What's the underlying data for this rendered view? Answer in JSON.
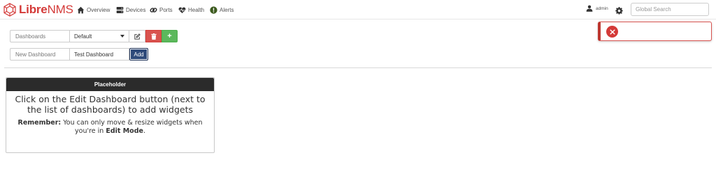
{
  "app": {
    "logo_part1": "Libre",
    "logo_part2": "NMS",
    "brand_color": "#d43a38"
  },
  "nav": {
    "items": [
      {
        "label": "Overview",
        "icon": "home-icon"
      },
      {
        "label": "Devices",
        "icon": "server-icon"
      },
      {
        "label": "Ports",
        "icon": "link-icon"
      },
      {
        "label": "Health",
        "icon": "heartbeat-icon"
      },
      {
        "label": "Alerts",
        "icon": "exclamation-circle-icon"
      }
    ],
    "user": "admin",
    "search_placeholder": "Global Search"
  },
  "dashboard": {
    "select_label": "Dashboards",
    "selected": "Default",
    "new_label": "New Dashboard",
    "new_value": "Test Dashboard",
    "add_button": "Add",
    "add_widget_symbol": "+"
  },
  "widget": {
    "title": "Placeholder",
    "message": "Click on the Edit Dashboard button (next to the list of dashboards) to add widgets",
    "remember_prefix": "Remember:",
    "remember_text": " You can only move & resize widgets when you're in ",
    "remember_mode": "Edit Mode",
    "remember_suffix": "."
  },
  "colors": {
    "danger": "#d9534f",
    "success": "#5cb85c",
    "primary": "#2e4a7a",
    "widget_header": "#2b2b2b"
  }
}
